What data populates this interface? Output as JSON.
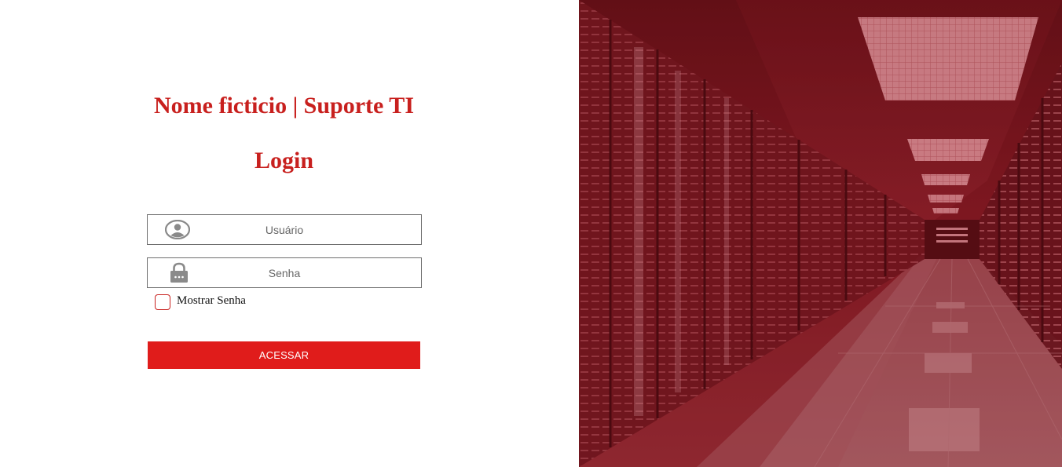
{
  "header": {
    "brand_title": "Nome ficticio | Suporte TI",
    "login_heading": "Login"
  },
  "form": {
    "username": {
      "placeholder": "Usuário",
      "value": "",
      "icon": "user-circle-icon"
    },
    "password": {
      "placeholder": "Senha",
      "value": "",
      "icon": "lock-icon"
    },
    "show_password": {
      "label": "Mostrar Senha",
      "checked": false
    },
    "submit_label": "ACESSAR"
  },
  "hero": {
    "image": "server-room-photo"
  },
  "colors": {
    "accent": "#c8201e",
    "button": "#e01c1b",
    "overlay": "#8a1a22"
  }
}
